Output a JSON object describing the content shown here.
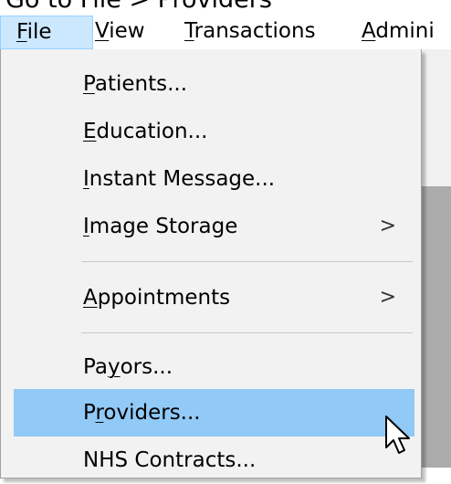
{
  "caption": "Go to File > Providers",
  "menubar": {
    "items": [
      {
        "mnemonic": "F",
        "rest": "ile",
        "active": true
      },
      {
        "mnemonic": "V",
        "rest": "iew",
        "active": false
      },
      {
        "mnemonic": "T",
        "rest": "ransactions",
        "active": false
      },
      {
        "mnemonic": "A",
        "rest": "dmini",
        "active": false
      }
    ]
  },
  "file_menu": {
    "items": [
      {
        "pre": "",
        "mnemonic": "P",
        "post": "atients...",
        "submenu": false
      },
      {
        "pre": "",
        "mnemonic": "E",
        "post": "ducation...",
        "submenu": false
      },
      {
        "pre": "",
        "mnemonic": "I",
        "post": "nstant Message...",
        "submenu": false
      },
      {
        "pre": "",
        "mnemonic": "I",
        "post": "mage Storage",
        "submenu": true,
        "arrow": ">"
      },
      {
        "pre": "",
        "mnemonic": "A",
        "post": "ppointments",
        "submenu": true,
        "arrow": ">"
      },
      {
        "pre": "Pa",
        "mnemonic": "y",
        "post": "ors...",
        "submenu": false
      },
      {
        "pre": "P",
        "mnemonic": "r",
        "post": "oviders...",
        "submenu": false,
        "highlighted": true
      },
      {
        "pre": "NHS Contracts...",
        "mnemonic": "",
        "post": "",
        "submenu": false
      }
    ]
  },
  "colors": {
    "menubar_active_bg": "#cce8ff",
    "menu_highlight_bg": "#91c9f7",
    "menu_bg": "#f2f2f2"
  },
  "icons": {
    "pointer": "mouse-pointer-icon"
  }
}
